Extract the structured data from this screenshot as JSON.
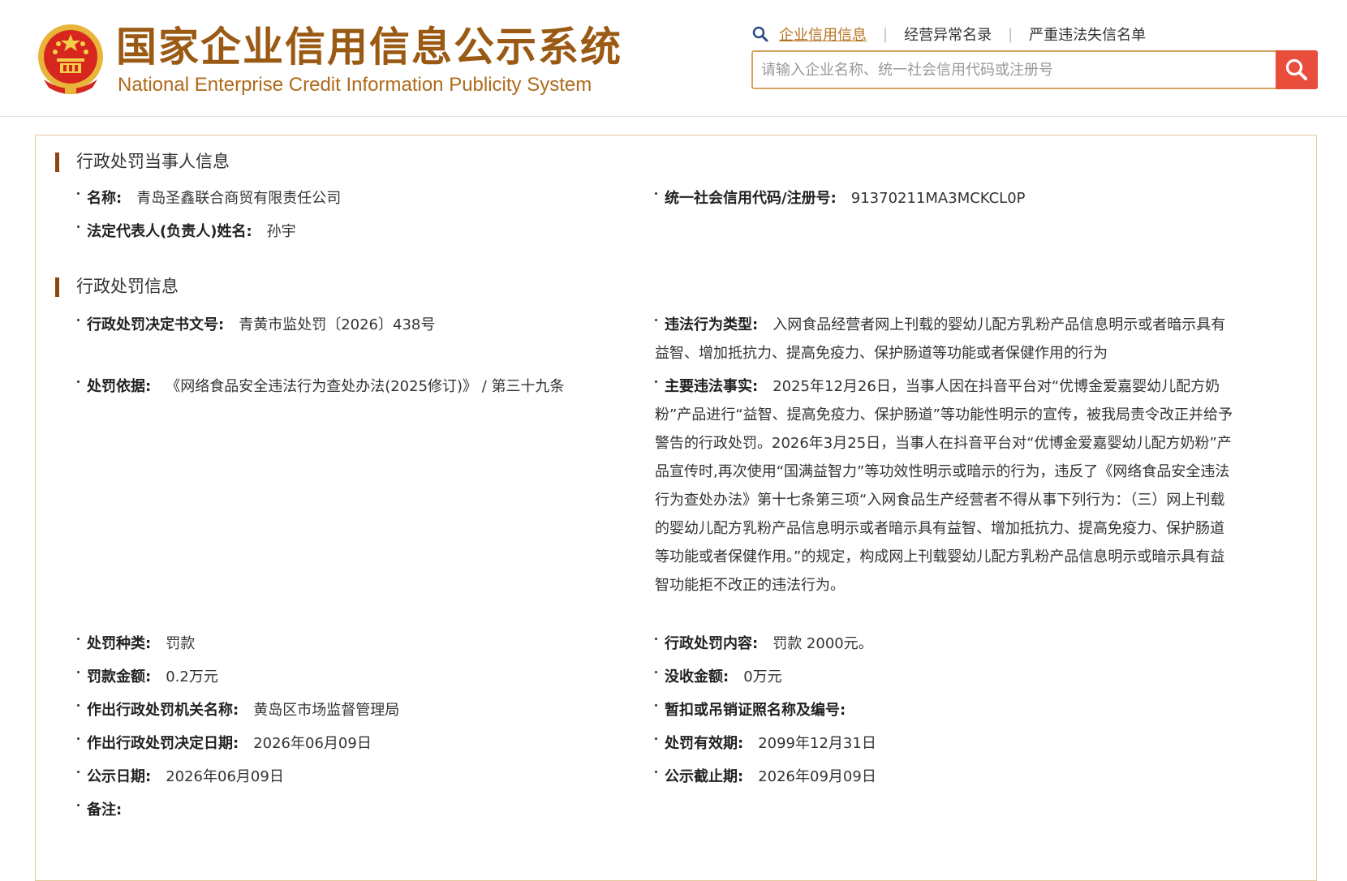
{
  "header": {
    "title_cn": "国家企业信用信息公示系统",
    "title_en": "National Enterprise Credit Information Publicity System",
    "nav": [
      {
        "label": "企业信用信息"
      },
      {
        "label": "经营异常名录"
      },
      {
        "label": "严重违法失信名单"
      }
    ],
    "search": {
      "placeholder": "请输入企业名称、统一社会信用代码或注册号",
      "value": ""
    },
    "colors": {
      "brand": "#9a5a14",
      "accent": "#d9a463",
      "search_button": "#e94d3c"
    }
  },
  "party": {
    "title": "行政处罚当事人信息",
    "name_label": "名称:",
    "name_value": "青岛圣鑫联合商贸有限责任公司",
    "code_label": "统一社会信用代码/注册号:",
    "code_value": "91370211MA3MCKCL0P",
    "rep_label": "法定代表人(负责人)姓名:",
    "rep_value": "孙宇"
  },
  "penalty": {
    "title": "行政处罚信息",
    "doc_label": "行政处罚决定书文号:",
    "doc_value": "青黄市监处罚〔2026〕438号",
    "type_label": "违法行为类型:",
    "type_value": "入网食品经营者网上刊载的婴幼儿配方乳粉产品信息明示或者暗示具有益智、增加抵抗力、提高免疫力、保护肠道等功能或者保健作用的行为",
    "basis_label": "处罚依据:",
    "basis_value": "《网络食品安全违法行为查处办法(2025修订)》 / 第三十九条",
    "facts_label": "主要违法事实:",
    "facts_value": "2025年12月26日，当事人因在抖音平台对“优博金爱嘉婴幼儿配方奶粉”产品进行“益智、提高免疫力、保护肠道”等功能性明示的宣传，被我局责令改正并给予警告的行政处罚。2026年3月25日，当事人在抖音平台对“优博金爱嘉婴幼儿配方奶粉”产品宣传时,再次使用“国满益智力”等功效性明示或暗示的行为，违反了《网络食品安全违法行为查处办法》第十七条第三项“入网食品生产经营者不得从事下列行为：（三）网上刊载的婴幼儿配方乳粉产品信息明示或者暗示具有益智、增加抵抗力、提高免疫力、保护肠道等功能或者保健作用。”的规定，构成网上刊载婴幼儿配方乳粉产品信息明示或暗示具有益智功能拒不改正的违法行为。",
    "kind_label": "处罚种类:",
    "kind_value": "罚款",
    "content_label": "行政处罚内容:",
    "content_value": "罚款 2000元。",
    "fine_label": "罚款金额:",
    "fine_value": "0.2万元",
    "confiscate_label": "没收金额:",
    "confiscate_value": "0万元",
    "authority_label": "作出行政处罚机关名称:",
    "authority_value": "黄岛区市场监督管理局",
    "license_label": "暂扣或吊销证照名称及编号:",
    "license_value": "",
    "date_label": "作出行政处罚决定日期:",
    "date_value": "2026年06月09日",
    "validity_label": "处罚有效期:",
    "validity_value": "2099年12月31日",
    "publish_label": "公示日期:",
    "publish_value": "2026年06月09日",
    "publish_end_label": "公示截止期:",
    "publish_end_value": "2026年09月09日",
    "remark_label": "备注:",
    "remark_value": ""
  }
}
